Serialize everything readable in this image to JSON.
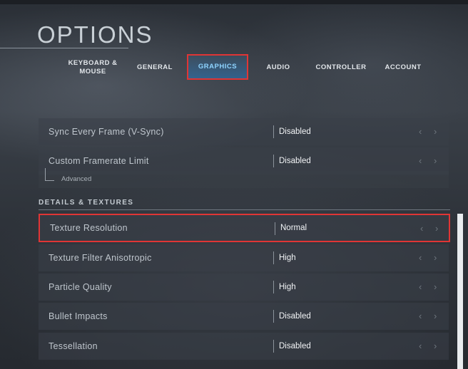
{
  "page": {
    "title": "OPTIONS"
  },
  "tabs": [
    {
      "line1": "KEYBOARD &",
      "line2": "MOUSE"
    },
    {
      "line1": "GENERAL",
      "line2": ""
    },
    {
      "line1": "GRAPHICS",
      "line2": ""
    },
    {
      "line1": "AUDIO",
      "line2": ""
    },
    {
      "line1": "CONTROLLER",
      "line2": ""
    },
    {
      "line1": "ACCOUNT",
      "line2": ""
    }
  ],
  "active_tab": "GRAPHICS",
  "top_settings": [
    {
      "label": "Sync Every Frame (V-Sync)",
      "value": "Disabled"
    },
    {
      "label": "Custom Framerate Limit",
      "value": "Disabled"
    }
  ],
  "sub_setting": {
    "label": "Advanced"
  },
  "section": {
    "title": "DETAILS & TEXTURES"
  },
  "details_settings": [
    {
      "label": "Texture Resolution",
      "value": "Normal"
    },
    {
      "label": "Texture Filter Anisotropic",
      "value": "High"
    },
    {
      "label": "Particle Quality",
      "value": "High"
    },
    {
      "label": "Bullet Impacts",
      "value": "Disabled"
    },
    {
      "label": "Tessellation",
      "value": "Disabled"
    }
  ],
  "icons": {
    "prev": "chevron-left-icon",
    "next": "chevron-right-icon"
  },
  "colors": {
    "highlight": "#e03535",
    "active_tab_text": "#8fd4ff"
  }
}
